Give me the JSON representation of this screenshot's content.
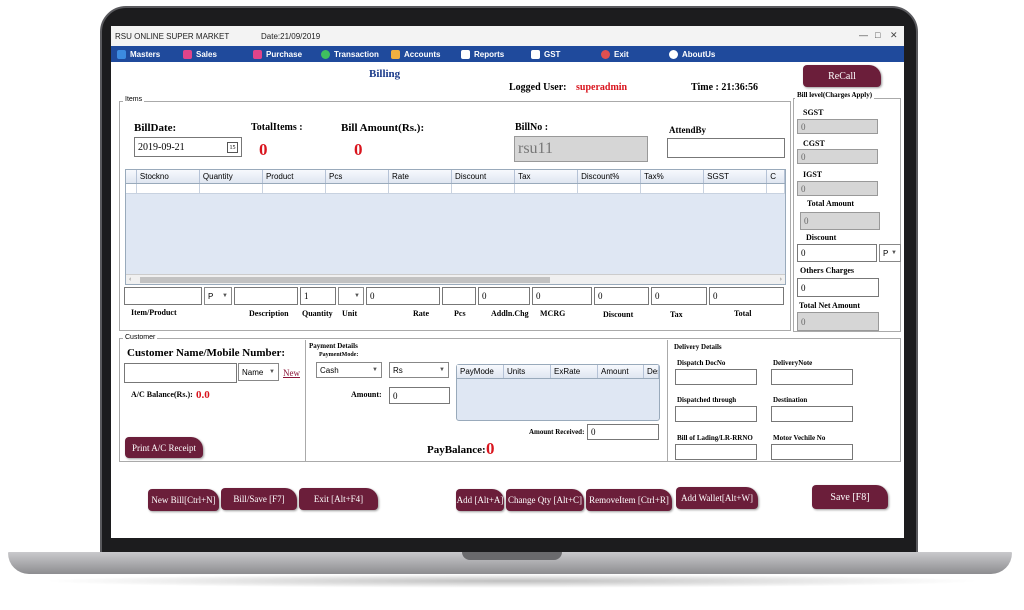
{
  "titlebar": {
    "app_name": "RSU ONLINE SUPER MARKET",
    "date": "Date:21/09/2019"
  },
  "menu": [
    {
      "label": "Masters",
      "icon": "folder-icon",
      "color": "#3c8be0"
    },
    {
      "label": "Sales",
      "icon": "bag-icon",
      "color": "#e0448a"
    },
    {
      "label": "Purchase",
      "icon": "cart-icon",
      "color": "#e0448a"
    },
    {
      "label": "Transaction",
      "icon": "transaction-icon",
      "color": "#3fbf5f"
    },
    {
      "label": "Accounts",
      "icon": "accounts-icon",
      "color": "#f0b040"
    },
    {
      "label": "Reports",
      "icon": "reports-icon",
      "color": "#ffffff"
    },
    {
      "label": "GST",
      "icon": "gst-icon",
      "color": "#ffffff"
    },
    {
      "label": "Exit",
      "icon": "exit-icon",
      "color": "#e05050"
    },
    {
      "label": "AboutUs",
      "icon": "info-icon",
      "color": "#ffffff"
    }
  ],
  "header": {
    "title": "Billing",
    "logged_user_label": "Logged User:",
    "logged_user": "superadmin",
    "time": "Time : 21:36:56",
    "recall_label": "ReCall"
  },
  "items": {
    "section_label": "Items",
    "bill_date_label": "BillDate:",
    "bill_date": "2019-09-21",
    "total_items_label": "TotalItems :",
    "total_items": "0",
    "bill_amount_label": "Bill Amount(Rs.):",
    "bill_amount": "0",
    "bill_no_label": "BillNo :",
    "bill_no": "rsu11",
    "attend_by_label": "AttendBy",
    "attend_by": "",
    "grid_columns": [
      "Stockno",
      "Quantity",
      "Product",
      "Pcs",
      "Rate",
      "Discount",
      "Tax",
      "Discount%",
      "Tax%",
      "SGST",
      "C"
    ],
    "entry": {
      "item_product": "",
      "p_select": "P",
      "description": "",
      "quantity": "1",
      "unit": "",
      "rate": "0",
      "pcs": "",
      "addln_chg": "0",
      "mcrg": "0",
      "discount": "0",
      "tax": "0",
      "total": "0"
    },
    "entry_labels": [
      "Item/Product",
      "Description",
      "Quantity",
      "Unit",
      "Rate",
      "Pcs",
      "Addln.Chg",
      "MCRG",
      "Discount",
      "Tax",
      "Total"
    ]
  },
  "bill_level": {
    "title": "Bill level(Charges Apply)",
    "sgst_label": "SGST",
    "sgst": "0",
    "cgst_label": "CGST",
    "cgst": "0",
    "igst_label": "IGST",
    "igst": "0",
    "total_amount_label": "Total Amount",
    "total_amount": "0",
    "discount_label": "Discount",
    "discount": "0",
    "discount_type": "P",
    "others_label": "Others Charges",
    "others": "0",
    "total_net_label": "Total Net Amount",
    "total_net": "0"
  },
  "customer": {
    "section_label": "Customer",
    "name_label": "Customer Name/Mobile Number:",
    "name_value": "",
    "search_by": "Name",
    "new_label": "New",
    "ac_balance_label": "A/C Balance(Rs.):",
    "ac_balance": "0.0",
    "print_receipt_label": "Print A/C Receipt"
  },
  "payment": {
    "title": "Payment Details",
    "mode_label": "PaymentMode:",
    "mode": "Cash",
    "currency": "Rs",
    "amount_label": "Amount:",
    "amount": "0",
    "grid_columns": [
      "PayMode",
      "Units",
      "ExRate",
      "Amount",
      "Des"
    ],
    "amount_received_label": "Amount Received:",
    "amount_received": "0",
    "pay_balance_label": "PayBalance:",
    "pay_balance": "0"
  },
  "delivery": {
    "title": "Delivery Details",
    "dispatch_docno": "Dispatch DocNo",
    "delivery_note": "DeliveryNote",
    "dispatched_through": "Dispatched through",
    "destination": "Destination",
    "bill_of_lading": "Bill of Lading/LR-RRNO",
    "motor_vehicle": "Motor Vechile No"
  },
  "actions": {
    "new_bill": "New Bill[Ctrl+N]",
    "bill_save": "Bill/Save [F7]",
    "exit": "Exit [Alt+F4]",
    "add": "Add [Alt+A]",
    "change_qty": "Change Qty [Alt+C]",
    "remove_item": "RemoveItem [Ctrl+R]",
    "add_wallet": "Add Wallet[Alt+W]",
    "save": "Save [F8]"
  },
  "colors": {
    "menubar": "#1f4a9c",
    "button": "#6b1e3a",
    "accent_red": "#d9141d"
  }
}
